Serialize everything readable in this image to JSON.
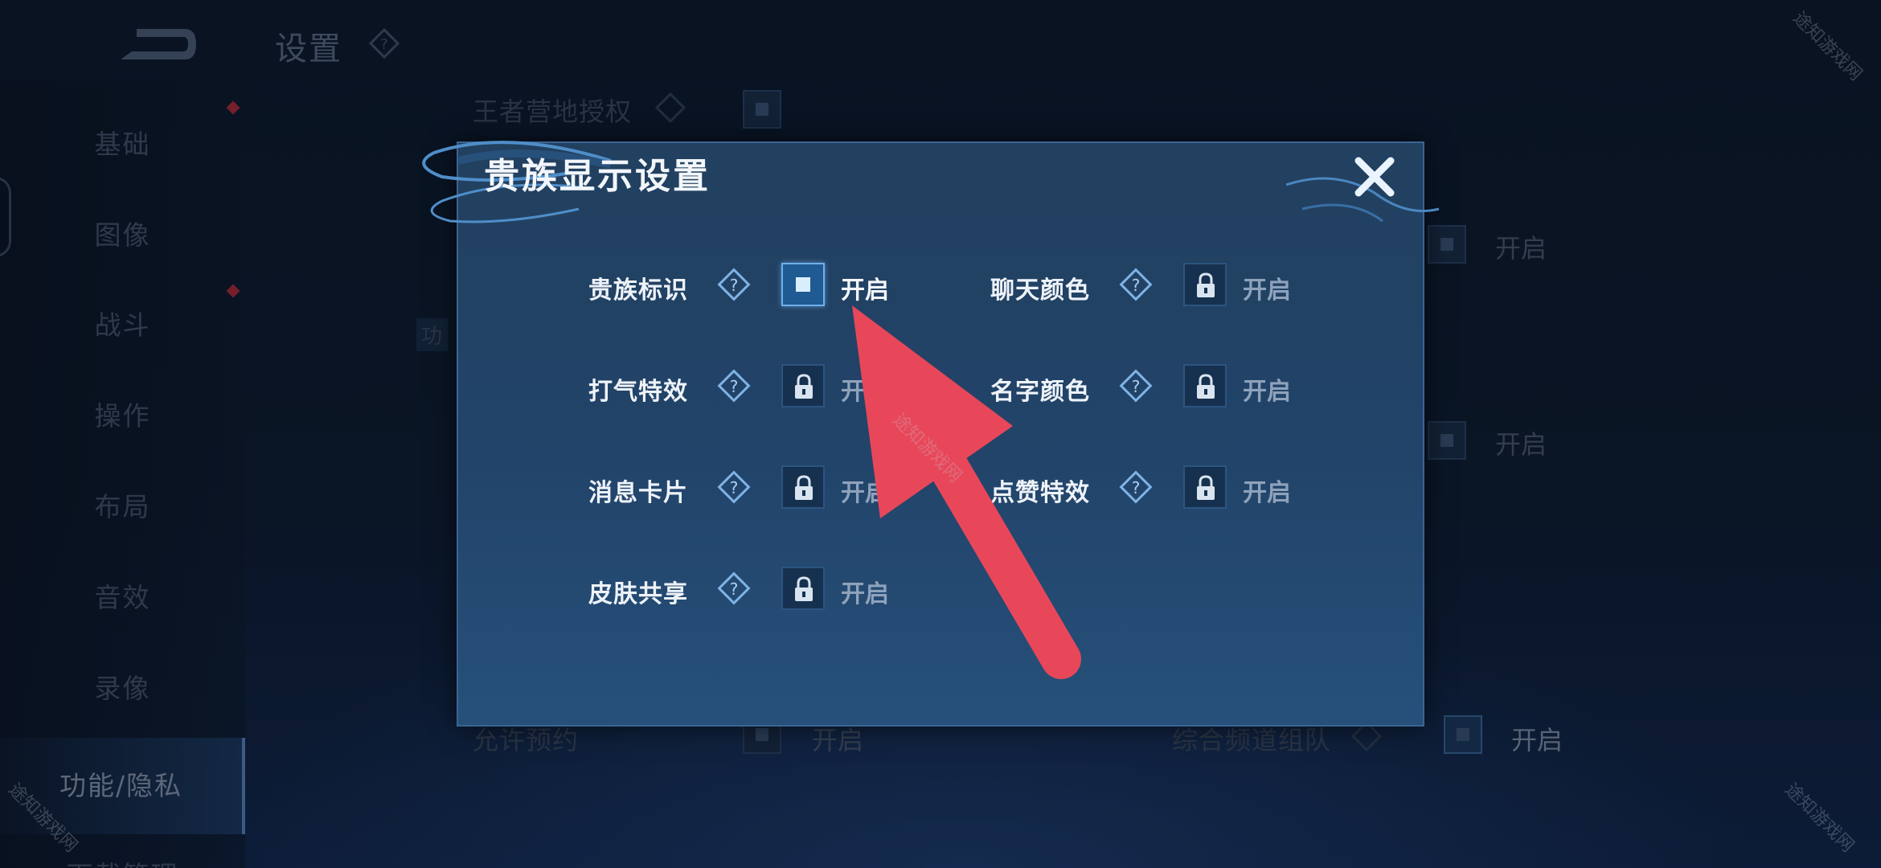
{
  "page": {
    "title": "设置"
  },
  "sidebar": {
    "items": [
      {
        "label": "基础"
      },
      {
        "label": "图像"
      },
      {
        "label": "战斗"
      },
      {
        "label": "操作"
      },
      {
        "label": "布局"
      },
      {
        "label": "音效"
      },
      {
        "label": "录像"
      },
      {
        "label": "功能/隐私",
        "active": true
      },
      {
        "label": "下载管理"
      }
    ]
  },
  "background_settings": {
    "camp_auth_label": "王者营地授权",
    "row2_right_state": "开启",
    "row3_right_state": "开启",
    "allow_reserve_label": "允许预约",
    "allow_reserve_state": "开启",
    "channel_team_label": "综合频道组队",
    "channel_team_state": "开启",
    "partial_label": "功"
  },
  "dialog": {
    "title": "贵族显示设置",
    "options": [
      {
        "label": "贵族标识",
        "state": "开启",
        "enabled": true,
        "locked": false
      },
      {
        "label": "聊天颜色",
        "state": "开启",
        "enabled": false,
        "locked": true
      },
      {
        "label": "打气特效",
        "state": "开启",
        "enabled": false,
        "locked": true
      },
      {
        "label": "名字颜色",
        "state": "开启",
        "enabled": false,
        "locked": true
      },
      {
        "label": "消息卡片",
        "state": "开启",
        "enabled": false,
        "locked": true
      },
      {
        "label": "点赞特效",
        "state": "开启",
        "enabled": false,
        "locked": true
      },
      {
        "label": "皮肤共享",
        "state": "开启",
        "enabled": false,
        "locked": true
      }
    ]
  },
  "watermark": "途知游戏网",
  "colors": {
    "annotation_arrow": "#e8475a",
    "dialog_bg": "#22446a",
    "checkbox_on": "#1f5a92"
  }
}
